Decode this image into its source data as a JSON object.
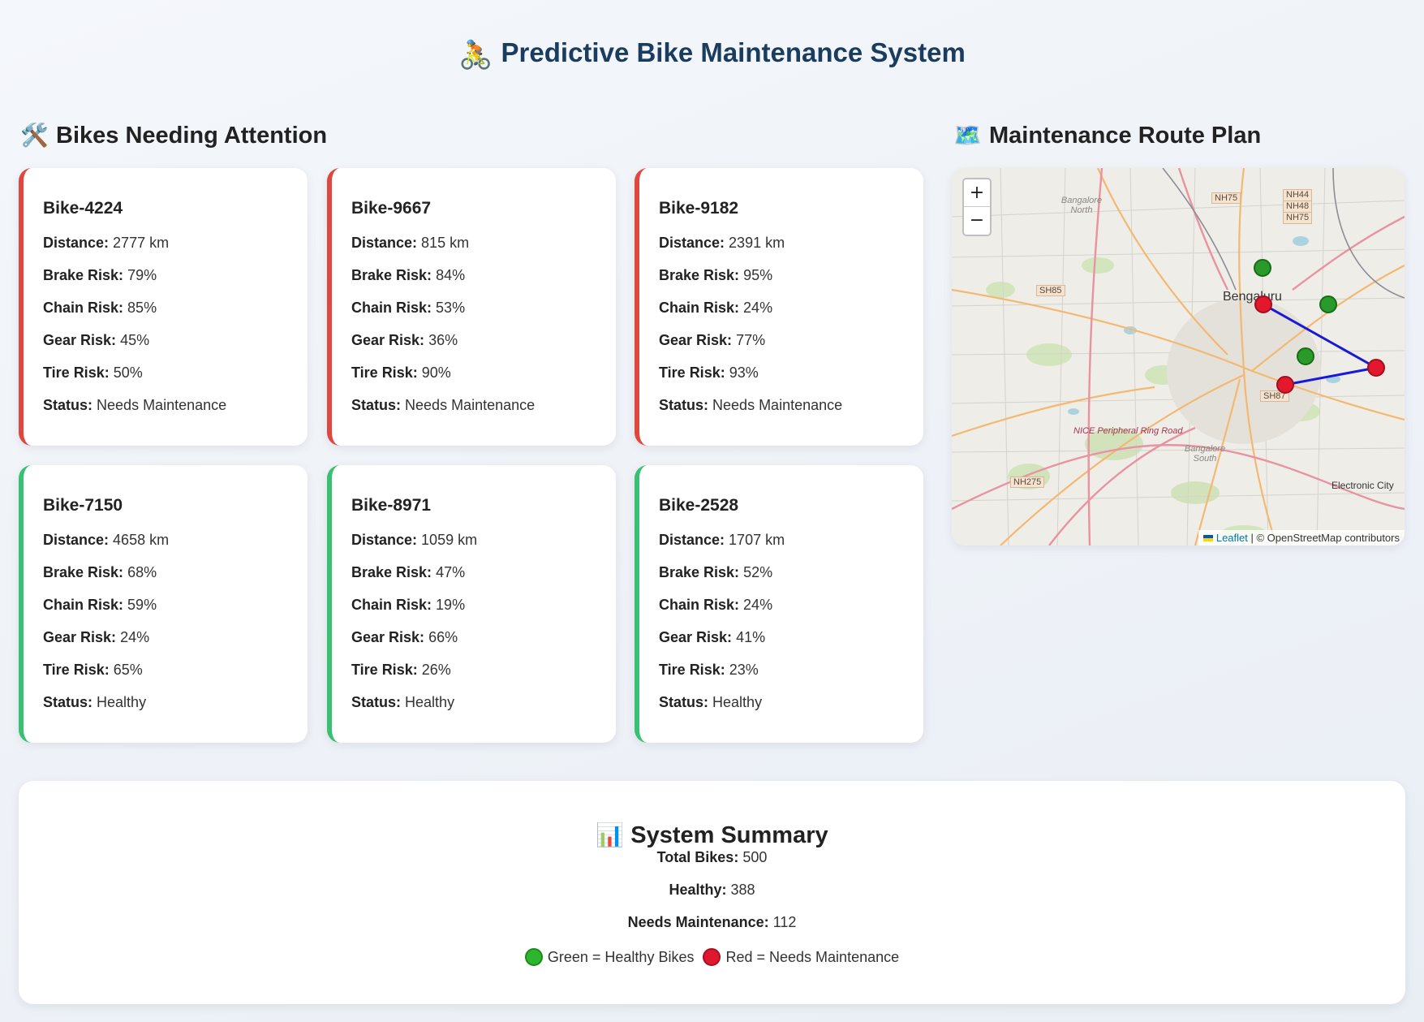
{
  "header": {
    "title": "Predictive Bike Maintenance System",
    "icon": "🚴"
  },
  "attention": {
    "title": "Bikes Needing Attention",
    "icon": "🛠️"
  },
  "labels": {
    "distance": "Distance:",
    "brake": "Brake Risk:",
    "chain": "Chain Risk:",
    "gear": "Gear Risk:",
    "tire": "Tire Risk:",
    "status": "Status:"
  },
  "bikes": [
    {
      "id": "Bike-4224",
      "distance": "2777 km",
      "brake": "79%",
      "chain": "85%",
      "gear": "45%",
      "tire": "50%",
      "status": "Needs Maintenance"
    },
    {
      "id": "Bike-9667",
      "distance": "815 km",
      "brake": "84%",
      "chain": "53%",
      "gear": "36%",
      "tire": "90%",
      "status": "Needs Maintenance"
    },
    {
      "id": "Bike-9182",
      "distance": "2391 km",
      "brake": "95%",
      "chain": "24%",
      "gear": "77%",
      "tire": "93%",
      "status": "Needs Maintenance"
    },
    {
      "id": "Bike-7150",
      "distance": "4658 km",
      "brake": "68%",
      "chain": "59%",
      "gear": "24%",
      "tire": "65%",
      "status": "Healthy"
    },
    {
      "id": "Bike-8971",
      "distance": "1059 km",
      "brake": "47%",
      "chain": "19%",
      "gear": "66%",
      "tire": "26%",
      "status": "Healthy"
    },
    {
      "id": "Bike-2528",
      "distance": "1707 km",
      "brake": "52%",
      "chain": "24%",
      "gear": "41%",
      "tire": "23%",
      "status": "Healthy"
    }
  ],
  "route": {
    "title": "Maintenance Route Plan",
    "icon": "🗺️",
    "map_labels": {
      "city": "Bengaluru",
      "bangalore_north": "Bangalore North",
      "bangalore_south": "Bangalore South",
      "electronic_city": "Electronic City",
      "ring_road": "NICE Peripheral Ring Road",
      "nh75": "NH75",
      "nh44": "NH44",
      "nh48": "NH48",
      "nh75b": "NH75",
      "sh85": "SH85",
      "sh87": "SH87",
      "nh275": "NH275"
    },
    "zoom_in": "+",
    "zoom_out": "−",
    "attribution_leaflet": "Leaflet",
    "attribution_rest": " | © OpenStreetMap contributors"
  },
  "summary": {
    "title": "System Summary",
    "icon": "📊",
    "total_label": "Total Bikes:",
    "total": "500",
    "healthy_label": "Healthy:",
    "healthy": "388",
    "maint_label": "Needs Maintenance:",
    "maint": "112",
    "legend_green": "Green = Healthy Bikes",
    "legend_red": "Red = Needs Maintenance"
  },
  "colors": {
    "maintenance": "#e0473e",
    "healthy": "#38c172",
    "title": "#1a3c5e",
    "route": "#1a1ad6"
  }
}
